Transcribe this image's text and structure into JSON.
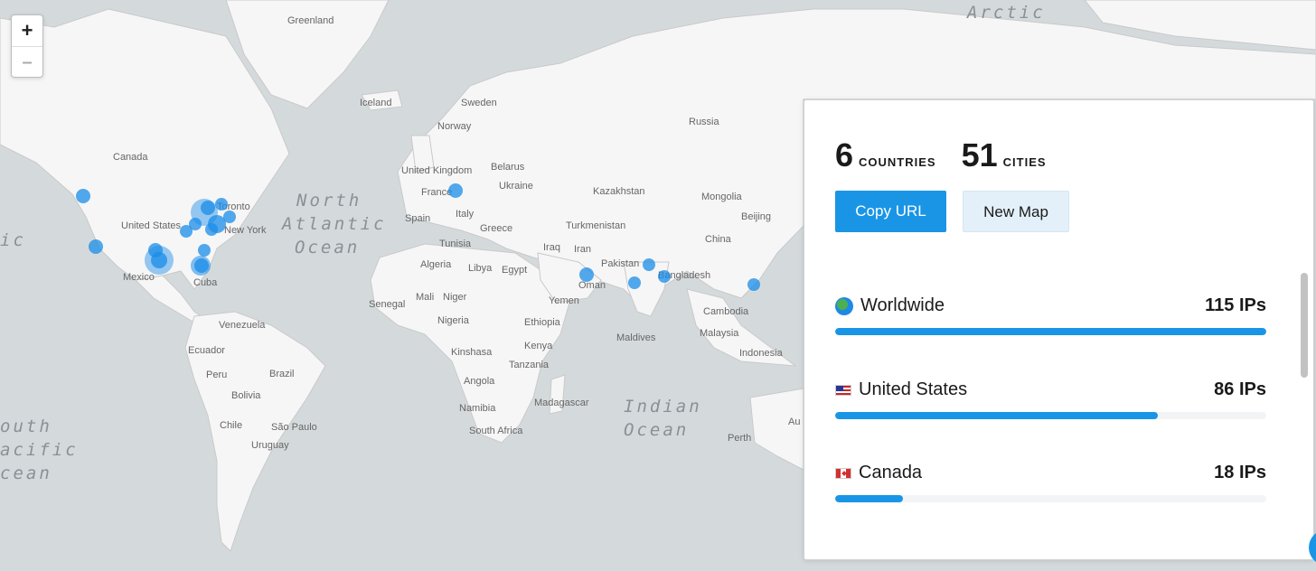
{
  "map": {
    "labels": {
      "oceans": [
        "North",
        "Atlantic",
        "Ocean",
        "Indian",
        "Ocean",
        "Arctic",
        "outh",
        "acific",
        "cean",
        "ic"
      ],
      "places": [
        "Greenland",
        "Iceland",
        "Sweden",
        "Norway",
        "Russia",
        "Canada",
        "United Kingdom",
        "Belarus",
        "Ukraine",
        "France",
        "Italy",
        "Spain",
        "Greece",
        "Kazakhstan",
        "Mongolia",
        "Beijing",
        "China",
        "Turkmenistan",
        "Iraq",
        "Iran",
        "Pakistan",
        "Bangladesh",
        "Tunisia",
        "Algeria",
        "Libya",
        "Egypt",
        "Oman",
        "Yemen",
        "Senegal",
        "Mali",
        "Niger",
        "Nigeria",
        "Ethiopia",
        "Kinshasa",
        "Kenya",
        "Tanzania",
        "Angola",
        "Namibia",
        "South Africa",
        "Madagascar",
        "Maldives",
        "Malaysia",
        "Cambodia",
        "Indonesia",
        "Perth",
        "Au",
        "United States",
        "New York",
        "Toronto",
        "Mexico",
        "Cuba",
        "Venezuela",
        "Ecuador",
        "Peru",
        "Brazil",
        "Bolivia",
        "Chile",
        "São Paulo",
        "Uruguay"
      ]
    },
    "colors": {
      "water": "#d4dadc",
      "land": "#f6f6f6",
      "border": "#c9c9c9",
      "marker": "#1a8ce8"
    }
  },
  "zoom": {
    "in": "+",
    "out": "–"
  },
  "panel": {
    "countries_count": "6",
    "countries_label": "COUNTRIES",
    "cities_count": "51",
    "cities_label": "CITIES",
    "copy_url": "Copy URL",
    "new_map": "New Map",
    "rows": [
      {
        "icon": "globe-icon",
        "name": "Worldwide",
        "count": "115 IPs",
        "fraction": 1.0
      },
      {
        "icon": "us-flag-icon",
        "name": "United States",
        "count": "86 IPs",
        "fraction": 0.748
      },
      {
        "icon": "canada-flag-icon",
        "name": "Canada",
        "count": "18 IPs",
        "fraction": 0.157
      }
    ]
  }
}
